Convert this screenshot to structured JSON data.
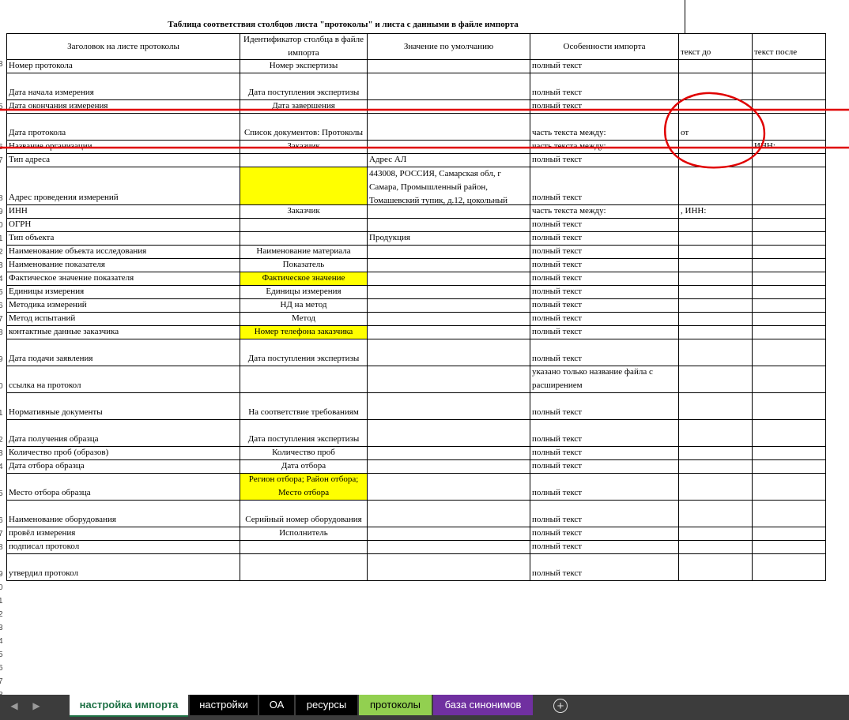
{
  "sheet": {
    "title": "Таблица соответствия столбцов листа \"протоколы\" и листа с данными в файле импорта",
    "columns": [
      "Заголовок на листе протоколы",
      "Идентификатор столбца в файле импорта",
      "Значение по умолчанию",
      "Особенности импорта",
      "текст до",
      "текст после"
    ],
    "visible_row_numbers": [
      "3",
      "",
      "5",
      "",
      "6",
      "7",
      "8",
      "9",
      "0",
      "1",
      "2",
      "3",
      "4",
      "5",
      "6",
      "7",
      "8",
      "9",
      "0",
      "1",
      "2",
      "3",
      "4",
      "5",
      "6",
      "7",
      "8",
      "9",
      "0",
      "1",
      "2",
      "3",
      "4",
      "5",
      "6",
      "7",
      "8",
      "9",
      "0"
    ],
    "rows": [
      {
        "header": "Номер протокола",
        "id": "Номер экспертизы",
        "default": "",
        "feature": "полный текст",
        "before": "",
        "after": ""
      },
      {
        "header": "Дата начала измерения",
        "id": "Дата поступления экспертизы",
        "default": "",
        "feature": "полный текст",
        "before": "",
        "after": ""
      },
      {
        "header": "Дата окончания измерения",
        "id": "Дата завершения",
        "default": "",
        "feature": "полный текст",
        "before": "",
        "after": ""
      },
      {
        "header": "Дата протокола",
        "id": "Список документов: Протоколы",
        "default": "",
        "feature": "часть текста между:",
        "before": "от",
        "after": ""
      },
      {
        "header": "Название организации",
        "id": "Заказчик",
        "default": "",
        "feature": "часть текста между:",
        "before": "",
        "after": "ИНН:"
      },
      {
        "header": "Тип адреса",
        "id": "",
        "default": "Адрес АЛ",
        "feature": "полный текст",
        "before": "",
        "after": ""
      },
      {
        "header": "Адрес проведения измерений",
        "id": "",
        "default": "443008, РОССИЯ, Самарская обл, г Самара, Промышленный район, Томашевский тупик, д.12, цокольный",
        "feature": "полный текст",
        "before": "",
        "after": ""
      },
      {
        "header": "ИНН",
        "id": "Заказчик",
        "default": "",
        "feature": "часть текста между:",
        "before": ", ИНН:",
        "after": ""
      },
      {
        "header": "ОГРН",
        "id": "",
        "default": "",
        "feature": "полный текст",
        "before": "",
        "after": ""
      },
      {
        "header": "Тип объекта",
        "id": "",
        "default": "Продукция",
        "feature": "полный текст",
        "before": "",
        "after": ""
      },
      {
        "header": "Наименование объекта исследования",
        "id": "Наименование материала",
        "default": "",
        "feature": "полный текст",
        "before": "",
        "after": ""
      },
      {
        "header": "Наименование показателя",
        "id": "Показатель",
        "default": "",
        "feature": "полный текст",
        "before": "",
        "after": ""
      },
      {
        "header": "Фактическое значение показателя",
        "id": "Фактическое значение",
        "default": "",
        "feature": "полный текст",
        "before": "",
        "after": ""
      },
      {
        "header": "Единицы измерения",
        "id": "Единицы измерения",
        "default": "",
        "feature": "полный текст",
        "before": "",
        "after": ""
      },
      {
        "header": "Методика измерений",
        "id": "НД на метод",
        "default": "",
        "feature": "полный текст",
        "before": "",
        "after": ""
      },
      {
        "header": "Метод испытаний",
        "id": "Метод",
        "default": "",
        "feature": "полный текст",
        "before": "",
        "after": ""
      },
      {
        "header": "контактные данные заказчика",
        "id": "Номер телефона заказчика",
        "default": "",
        "feature": "полный текст",
        "before": "",
        "after": ""
      },
      {
        "header": "Дата подачи заявления",
        "id": "Дата поступления экспертизы",
        "default": "",
        "feature": "полный текст",
        "before": "",
        "after": ""
      },
      {
        "header": "ссылка на протокол",
        "id": "",
        "default": "",
        "feature": "указано только название файла с расширением",
        "before": "",
        "after": ""
      },
      {
        "header": "Нормативные документы",
        "id": "На соответствие требованиям",
        "default": "",
        "feature": "полный текст",
        "before": "",
        "after": ""
      },
      {
        "header": "Дата получения образца",
        "id": "Дата поступления экспертизы",
        "default": "",
        "feature": "полный текст",
        "before": "",
        "after": ""
      },
      {
        "header": "Количество проб (образов)",
        "id": "Количество проб",
        "default": "",
        "feature": "полный текст",
        "before": "",
        "after": ""
      },
      {
        "header": "Дата отбора образца",
        "id": "Дата отбора",
        "default": "",
        "feature": "полный текст",
        "before": "",
        "after": ""
      },
      {
        "header": "Место отбора образца",
        "id": "Регион отбора; Район отбора; Место отбора",
        "default": "",
        "feature": "полный текст",
        "before": "",
        "after": ""
      },
      {
        "header": "Наименование оборудования",
        "id": "Серийный номер оборудования",
        "default": "",
        "feature": "полный текст",
        "before": "",
        "after": ""
      },
      {
        "header": "провёл измерения",
        "id": "Исполнитель",
        "default": "",
        "feature": "полный текст",
        "before": "",
        "after": ""
      },
      {
        "header": "подписал протокол",
        "id": "",
        "default": "",
        "feature": "полный текст",
        "before": "",
        "after": ""
      },
      {
        "header": "утвердил протокол",
        "id": "",
        "default": "",
        "feature": "полный текст",
        "before": "",
        "after": ""
      }
    ]
  },
  "tabs": [
    {
      "label": "настройка импорта",
      "active": true,
      "color": "#ffffff"
    },
    {
      "label": "настройки",
      "active": false,
      "color": "#000000"
    },
    {
      "label": "ОА",
      "active": false,
      "color": "#000000"
    },
    {
      "label": "ресурсы",
      "active": false,
      "color": "#000000"
    },
    {
      "label": "протоколы",
      "active": false,
      "color": "#92d050"
    },
    {
      "label": "база синонимов",
      "active": false,
      "color": "#7030a0"
    }
  ],
  "nav_icons": [
    "chevron-left-icon",
    "chevron-right-icon"
  ],
  "add_sheet_icon": "plus-circle-icon",
  "add_sheet_label": "+",
  "colors": {
    "highlight": "#ffff00",
    "annotation": "#e00000",
    "active_tab_text": "#1e7145"
  }
}
